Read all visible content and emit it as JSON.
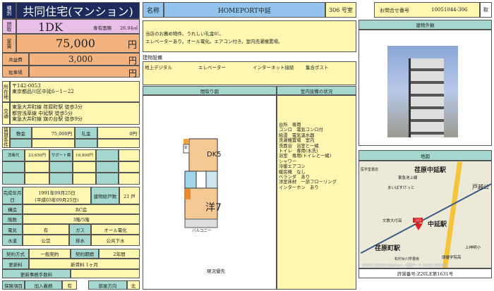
{
  "type_label": "種別",
  "type_value": "共同住宅(マンション)",
  "layout_label": "間取",
  "layout_value": "1DK",
  "area_label": "専有面積",
  "area_value": "26.94㎡",
  "rent_label": "家賃",
  "rent_value": "75,000",
  "yen": "円",
  "common_label": "共益費",
  "common_value": "3,000",
  "parking_label": "駐車場",
  "address_label": "所在地",
  "postal": "〒142-0053",
  "address": "東京都品川区中延6－1－22",
  "transit_label": "交通",
  "transit": [
    "東急大井町線 荏原町駅 徒歩3分",
    "都営浅草線 中延駅 徒歩5分",
    "東急大井町線 旗の台駅 徒歩9分"
  ],
  "lease_label": "賃貸条件",
  "deposit_label": "敷金",
  "deposit_value": "75,000円",
  "keymoney_label": "礼金",
  "keymoney_value": "0円",
  "fees": {
    "disinfect_label": "消毒代",
    "disinfect_value": "23,650円",
    "support_label": "サポート費",
    "support_value": "19,800円"
  },
  "built_label": "完成年月日",
  "built_value": "1991年09月25日",
  "built_value_jp": "(平成03年09月25日)",
  "units_label": "建物総戸数",
  "units_value": "21 戸",
  "structure_label": "構造",
  "structure_value": "RC造",
  "floor_label": "階数",
  "floor_value": "3階/5階",
  "elec_label": "電気",
  "elec_value": "有",
  "gas_label": "ガス",
  "gas_value": "オール電化",
  "water_label": "水道",
  "water_value": "公営",
  "drain_label": "排水",
  "drain_value": "公共下水",
  "contract_label": "契約方式",
  "contract_value": "一般契約",
  "term_label": "契約期間",
  "term_value": "2年間",
  "renew_label": "更新料",
  "renew_value": "新賃料 1ヶ月",
  "renew_fee_label": "更新事務手数料",
  "insurance_label": "保険項目",
  "insurance_req": "加入義務",
  "insurance_value": "有",
  "direction_label": "部屋方向",
  "direction_value": "北",
  "name_label": "名称",
  "name_value": "HOMEPORT中延",
  "room": "306 号室",
  "inquiry_label": "お問合せ番号",
  "inquiry_value": "10051044-306",
  "handling": "取",
  "remarks": [
    "当店のお薦め物件。うれしい礼金0!。",
    "エレベーターあり。オール電化。エアコン付き。室内洗濯機置場。"
  ],
  "facilities_label": "建物設備",
  "facilities": [
    "地上デジタル",
    "エレベーター",
    "インターネット接続",
    "集合ポスト"
  ],
  "floorplan_label": "間取り図",
  "floorplan_rooms": {
    "dk": "DK5",
    "western": "洋7",
    "balcony": "バルコニー",
    "entrance": "玄"
  },
  "floorplan_note": "現況優先",
  "equipment_label": "室内設備の状況",
  "equipment": [
    "台所　専用",
    "コンロ　電気コンロ付",
    "給湯　電気温水器",
    "洗濯機置場　室内",
    "洗面台　浴室と一緒",
    "トイレ　専用(水洗)",
    "浴室　専用(トイレと一緒)",
    "シャワー",
    "冷暖エアコン",
    "暖房機　なし",
    "ベランダ　あり",
    "洋室床材　一部フローリング",
    "インターホン　あり"
  ],
  "exterior_label": "建物外観",
  "map_label": "地図",
  "map_labels": [
    "荏原中延駅",
    "東急池上線",
    "まいばすけっと",
    "中延駅",
    "荏原町駅",
    "文教大付高",
    "上神明小",
    "戸越公",
    "松村女川学書房",
    "朋優学院高",
    "医学堂書店",
    "コロ"
  ],
  "map_copyright": "©2021 ZENRIN DataCom・地図データ ©2021 ZENRIN",
  "license": "許諾番号:Z20LE第1631号"
}
